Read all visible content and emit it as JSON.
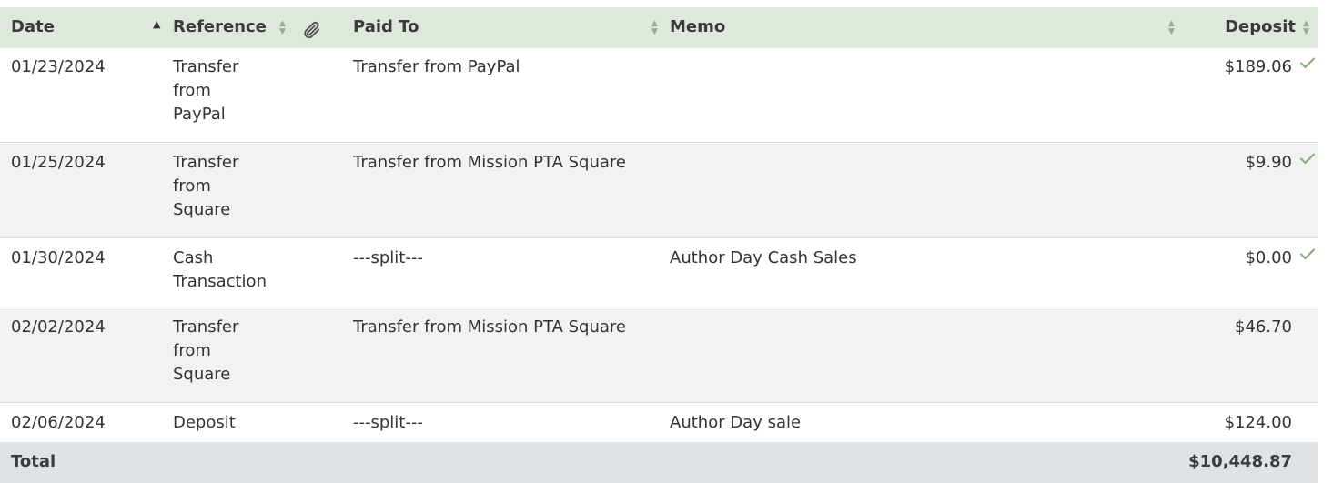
{
  "columns": {
    "date": "Date",
    "reference": "Reference",
    "paid_to": "Paid To",
    "memo": "Memo",
    "deposit": "Deposit"
  },
  "icons": {
    "sort_asc": "sort-ascending-icon",
    "sort_both": "sort-both-icon",
    "attachment": "paperclip-icon",
    "cleared": "checkmark-icon"
  },
  "rows": [
    {
      "date": "01/23/2024",
      "reference": "Transfer from PayPal",
      "paid_to": "Transfer from PayPal",
      "memo": "",
      "deposit": "$189.06",
      "cleared": true
    },
    {
      "date": "01/25/2024",
      "reference": "Transfer from Square",
      "paid_to": "Transfer from Mission PTA Square",
      "memo": "",
      "deposit": "$9.90",
      "cleared": true
    },
    {
      "date": "01/30/2024",
      "reference": "Cash Transaction",
      "paid_to": "---split---",
      "memo": "Author Day Cash Sales",
      "deposit": "$0.00",
      "cleared": true
    },
    {
      "date": "02/02/2024",
      "reference": "Transfer from Square",
      "paid_to": "Transfer from Mission PTA Square",
      "memo": "",
      "deposit": "$46.70",
      "cleared": false
    },
    {
      "date": "02/06/2024",
      "reference": "Deposit",
      "paid_to": "---split---",
      "memo": "Author Day sale",
      "deposit": "$124.00",
      "cleared": false
    }
  ],
  "total": {
    "label": "Total",
    "deposit": "$10,448.87"
  },
  "colors": {
    "header_bg": "#dfe8dd",
    "total_bg": "#dfe2e4",
    "row_alt_bg": "#f2f2f2",
    "check": "#8aa87e"
  }
}
